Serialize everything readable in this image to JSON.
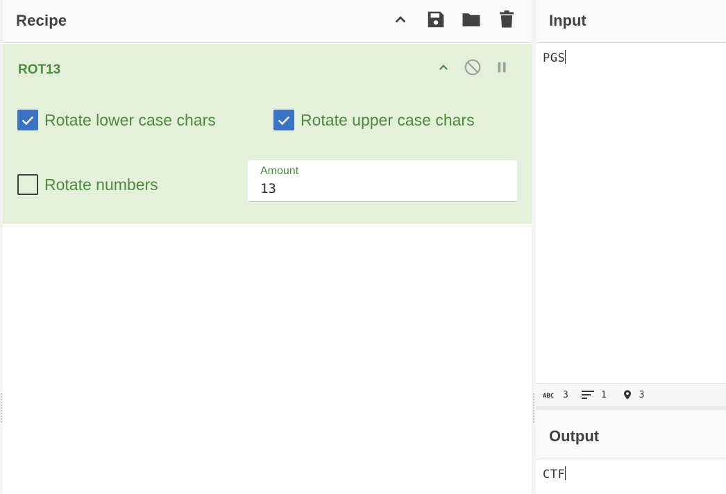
{
  "recipe": {
    "title": "Recipe",
    "buttons": [
      "collapse-all",
      "save-recipe",
      "load-recipe",
      "clear-recipe"
    ]
  },
  "operation": {
    "name": "ROT13",
    "options": {
      "lower": {
        "label": "Rotate lower case chars",
        "checked": true
      },
      "upper": {
        "label": "Rotate upper case chars",
        "checked": true
      },
      "numbers": {
        "label": "Rotate numbers",
        "checked": false
      }
    },
    "amount": {
      "label": "Amount",
      "value": "13"
    }
  },
  "input": {
    "title": "Input",
    "text": "PGS"
  },
  "status": {
    "length": "3",
    "lines": "1",
    "position": "3"
  },
  "output": {
    "title": "Output",
    "text": "CTF"
  },
  "colors": {
    "op_background": "#e4f0da",
    "op_text": "#4a8b3c",
    "checkbox": "#3b73c4",
    "icons": "#424242"
  }
}
